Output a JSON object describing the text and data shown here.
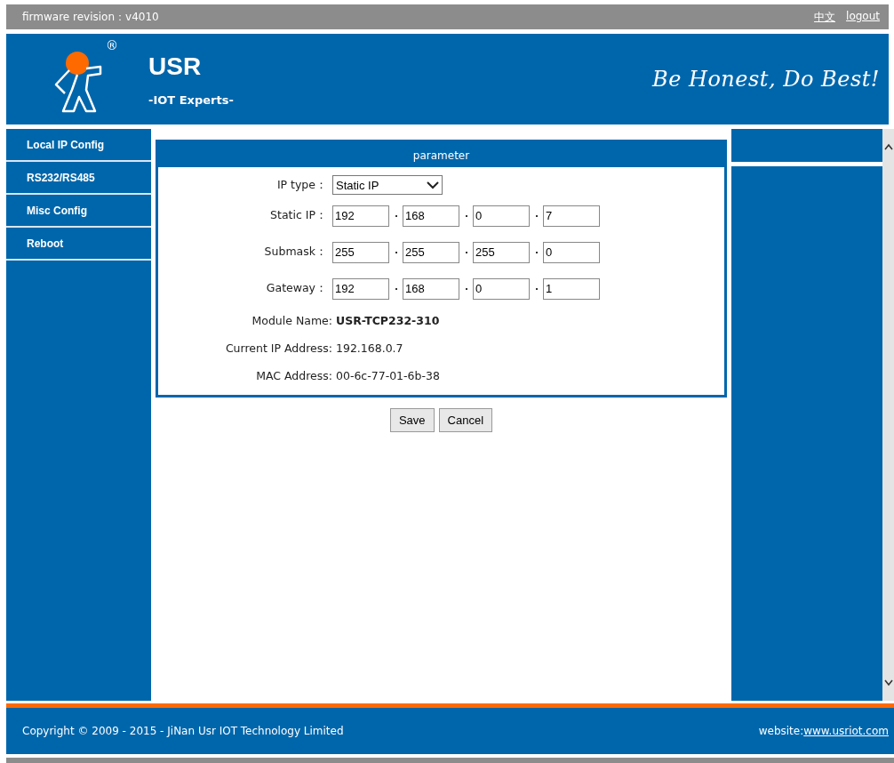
{
  "top_bar": {
    "firmware": "firmware revision：v4010",
    "language_link": "中文",
    "logout_link": "logout"
  },
  "header": {
    "registered_mark": "®",
    "brand": "USR",
    "tagline": "-IOT Experts-",
    "slogan": "Be Honest, Do Best!"
  },
  "sidebar": {
    "items": [
      {
        "label": "Local IP Config"
      },
      {
        "label": "RS232/RS485"
      },
      {
        "label": "Misc Config"
      },
      {
        "label": "Reboot"
      }
    ]
  },
  "panel": {
    "title": "parameter",
    "rows": [
      {
        "kind": "select",
        "label": "IP type：",
        "value": "Static IP"
      },
      {
        "kind": "ip",
        "label": "Static IP：",
        "octets": [
          "192",
          "168",
          "0",
          "7"
        ]
      },
      {
        "kind": "ip",
        "label": "Submask：",
        "octets": [
          "255",
          "255",
          "255",
          "0"
        ]
      },
      {
        "kind": "ip",
        "label": "Gateway：",
        "octets": [
          "192",
          "168",
          "0",
          "1"
        ]
      },
      {
        "kind": "info",
        "label": "Module Name:",
        "value": "USR-TCP232-310",
        "emphasis": true
      },
      {
        "kind": "info",
        "label": "Current IP Address:",
        "value": "192.168.0.7",
        "emphasis": false
      },
      {
        "kind": "info",
        "label": "MAC Address:",
        "value": "00-6c-77-01-6b-38",
        "emphasis": false
      }
    ]
  },
  "buttons": [
    "Save",
    "Cancel"
  ],
  "footer": {
    "copyright": "Copyright © 2009 - 2015 - JiNan Usr IOT Technology Limited",
    "website_label": "website:",
    "website_link": "www.usriot.com"
  }
}
